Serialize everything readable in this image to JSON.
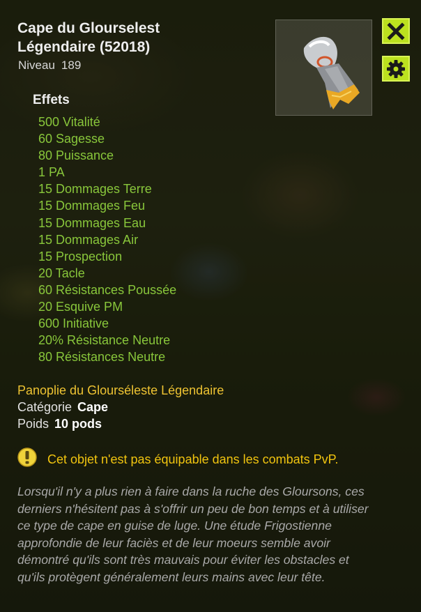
{
  "item": {
    "name_line1": "Cape du Glourselest",
    "name_line2": "Légendaire (52018)",
    "level_label": "Niveau",
    "level_value": "189"
  },
  "buttons": {
    "close_icon": "close-x-icon",
    "settings_icon": "gear-icon",
    "accent_color": "#bce11f"
  },
  "effects": {
    "title": "Effets",
    "color": "#89c73b",
    "items": [
      "500 Vitalité",
      "60 Sagesse",
      "80 Puissance",
      "1 PA",
      "15 Dommages Terre",
      "15 Dommages Feu",
      "15 Dommages Eau",
      "15 Dommages Air",
      "15 Prospection",
      "20 Tacle",
      "60 Résistances Poussée",
      "20 Esquive PM",
      "600 Initiative",
      "20% Résistance Neutre",
      "80 Résistances Neutre"
    ]
  },
  "info": {
    "set_name": "Panoplie du Glourséleste Légendaire",
    "category_label": "Catégorie",
    "category_value": "Cape",
    "weight_label": "Poids",
    "weight_value": "10 pods"
  },
  "warning": {
    "icon": "warning-icon",
    "text": "Cet objet n'est pas équipable dans les combats PvP."
  },
  "description": "Lorsqu'il n'y a plus rien à faire dans la ruche des Gloursons, ces derniers n'hésitent pas à s'offrir un peu de bon temps et à utiliser ce type de cape en guise de luge. Une étude Frigostienne approfondie de leur faciès et de leur moeurs semble avoir démontré qu'ils sont très mauvais pour éviter les obstacles et qu'ils protègent généralement leurs mains avec leur tête."
}
